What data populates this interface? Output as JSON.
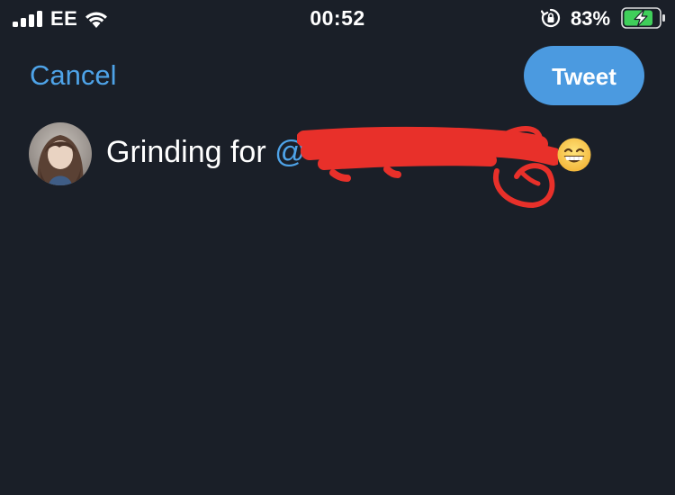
{
  "status_bar": {
    "carrier": "EE",
    "time": "00:52",
    "battery_percent": "83%",
    "battery_level": 0.83,
    "charging": true,
    "icons": [
      "signal-bars-icon",
      "wifi-icon",
      "orientation-lock-icon",
      "battery-charging-icon"
    ]
  },
  "header": {
    "cancel_label": "Cancel",
    "tweet_label": "Tweet"
  },
  "compose": {
    "text_prefix": "Grinding for ",
    "mention_prefix": "@",
    "mention_redacted": true,
    "emoji": "grinning-face-with-smiling-eyes"
  },
  "colors": {
    "background": "#1a1f28",
    "accent": "#4ea3e8",
    "tweet_button": "#4b9ae0",
    "redaction": "#e8302a",
    "battery_fill": "#3fcf5a"
  }
}
